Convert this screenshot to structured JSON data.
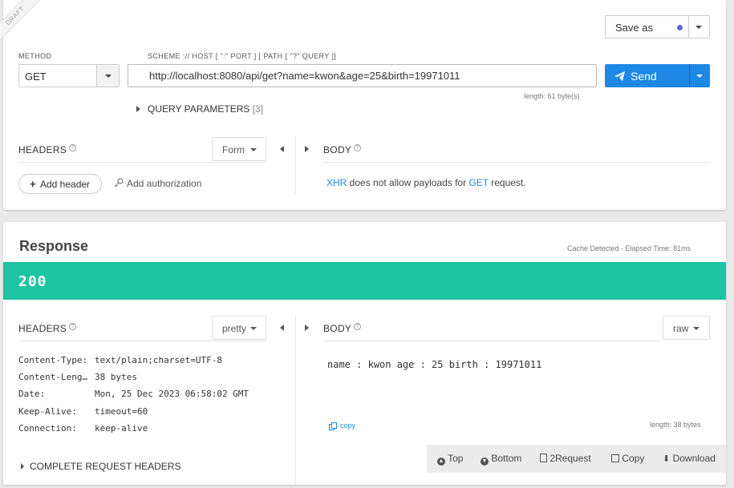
{
  "request": {
    "draft_label": "DRAFT",
    "save_as_label": "Save as",
    "method_label": "METHOD",
    "method_value": "GET",
    "url_label": "SCHEME :// HOST [ \":\" PORT ] [ PATH [ \"?\" QUERY ]]",
    "url_value": "http://localhost:8080/api/get?name=kwon&age=25&birth=19971011",
    "length_info": "length: 61 byte(s)",
    "send_label": "Send",
    "query_params_label": "QUERY PARAMETERS",
    "query_params_count": "[3]",
    "headers_title": "HEADERS",
    "headers_mode": "Form",
    "body_title": "BODY",
    "add_header_label": "Add header",
    "add_auth_label": "Add authorization",
    "body_note_xhr": "XHR",
    "body_note_mid": " does not allow payloads for ",
    "body_note_get": "GET",
    "body_note_end": " request."
  },
  "response": {
    "title": "Response",
    "cache_info": "Cache Detected - Elapsed Time: 81ms",
    "status_code": "200",
    "status_color": "#1dc3a3",
    "headers_title": "HEADERS",
    "headers_mode": "pretty",
    "body_title": "BODY",
    "body_mode": "raw",
    "headers": [
      {
        "key": "Content-Type:",
        "value": "text/plain;charset=UTF-8"
      },
      {
        "key": "Content-Leng…",
        "value": "38 bytes"
      },
      {
        "key": "Date:",
        "value": "Mon, 25 Dec 2023 06:58:02 GMT"
      },
      {
        "key": "Keep-Alive:",
        "value": "timeout=60"
      },
      {
        "key": "Connection:",
        "value": "keep-alive"
      }
    ],
    "complete_headers_label": "COMPLETE REQUEST HEADERS",
    "body_text": "name : kwon age : 25 birth : 19971011",
    "copy_label": "copy",
    "body_length": "length: 38 bytes",
    "toolbar": {
      "top": "Top",
      "bottom": "Bottom",
      "to_request": "2Request",
      "copy": "Copy",
      "download": "Download"
    }
  },
  "colors": {
    "accent": "#1e88e5",
    "success": "#1dc3a3"
  }
}
